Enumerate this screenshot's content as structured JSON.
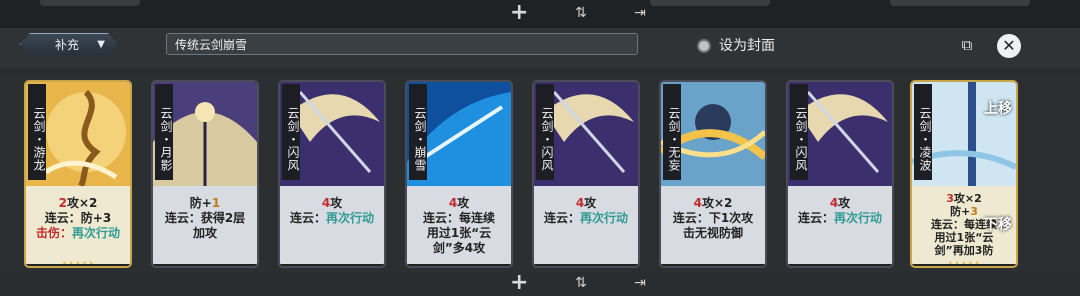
{
  "header": {
    "dropdown_label": "补充",
    "deck_name": "传统云剑崩雪",
    "cover_label": "设为封面"
  },
  "icons": {
    "plus": "+",
    "dropdown": "chevron-down-icon",
    "copy": "copy-icon",
    "close": "close-icon",
    "sort": "sort-icon",
    "export": "export-icon"
  },
  "colors": {
    "accent_red": "#c22b2b",
    "accent_green": "#2e9c94",
    "gold_border": "#c9a64a"
  },
  "cards": [
    {
      "name": "云剑・游龙",
      "lines": [
        [
          "2",
          "攻×2"
        ],
        [
          "连云：防+3"
        ],
        [
          "击伤：",
          "再次行动"
        ]
      ],
      "rarity": "gold"
    },
    {
      "name": "云剑・月影",
      "lines": [
        [
          "防+",
          "1"
        ],
        [
          "连云：获得2层"
        ],
        [
          "加攻"
        ]
      ],
      "rarity": "silver"
    },
    {
      "name": "云剑・闪风",
      "lines": [
        [
          "4",
          "攻"
        ],
        [
          "连云：",
          "再次行动"
        ]
      ],
      "rarity": "silver"
    },
    {
      "name": "云剑・崩雪",
      "lines": [
        [
          "4",
          "攻"
        ],
        [
          "连云：每连续"
        ],
        [
          "用过1张“云"
        ],
        [
          "剑”多4攻"
        ]
      ],
      "rarity": "silver"
    },
    {
      "name": "云剑・闪风",
      "lines": [
        [
          "4",
          "攻"
        ],
        [
          "连云：",
          "再次行动"
        ]
      ],
      "rarity": "silver"
    },
    {
      "name": "云剑・无妄",
      "lines": [
        [
          "4",
          "攻×2"
        ],
        [
          "连云：下1次攻"
        ],
        [
          "击无视防御"
        ]
      ],
      "rarity": "silver"
    },
    {
      "name": "云剑・闪风",
      "lines": [
        [
          "4",
          "攻"
        ],
        [
          "连云：",
          "再次行动"
        ]
      ],
      "rarity": "silver"
    },
    {
      "name": "云剑・凌波",
      "lines": [
        [
          "3",
          "攻×2"
        ],
        [
          "防+",
          "3"
        ],
        [
          "连云：每连续"
        ],
        [
          "用过1张“云"
        ],
        [
          "剑”再加3防"
        ]
      ],
      "rarity": "gold"
    }
  ],
  "overlays": {
    "move_up": "上移",
    "move_down": "下移"
  }
}
